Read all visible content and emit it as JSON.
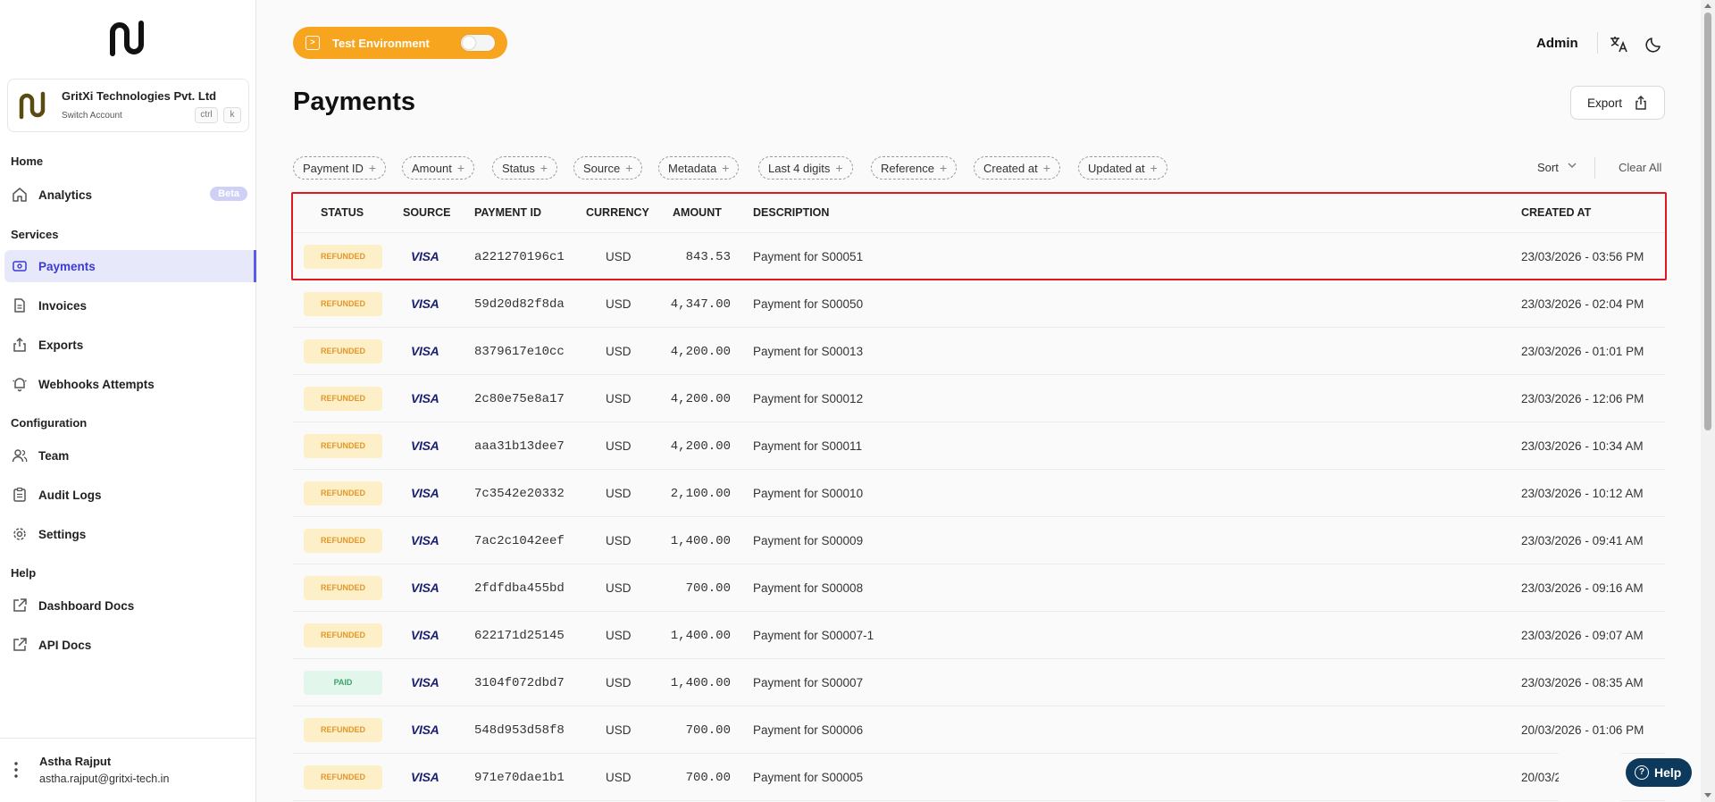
{
  "org": {
    "name": "GritXi Technologies Pvt. Ltd",
    "switch_label": "Switch Account",
    "kbd_ctrl": "ctrl",
    "kbd_k": "k"
  },
  "sidebar": {
    "sections": [
      {
        "label": "Home"
      },
      {
        "label": "Services"
      },
      {
        "label": "Configuration"
      },
      {
        "label": "Help"
      }
    ],
    "items": {
      "analytics": "Analytics",
      "analytics_badge": "Beta",
      "payments": "Payments",
      "invoices": "Invoices",
      "exports": "Exports",
      "webhooks": "Webhooks Attempts",
      "team": "Team",
      "audit_logs": "Audit Logs",
      "settings": "Settings",
      "dashboard_docs": "Dashboard Docs",
      "api_docs": "API Docs"
    }
  },
  "user": {
    "name": "Astha Rajput",
    "email": "astha.rajput@gritxi-tech.in"
  },
  "topbar": {
    "env_label": "Test Environment",
    "admin_label": "Admin"
  },
  "page": {
    "title": "Payments",
    "export_label": "Export"
  },
  "filters": [
    "Payment ID",
    "Amount",
    "Status",
    "Source",
    "Metadata",
    "Last 4 digits",
    "Reference",
    "Created at",
    "Updated at"
  ],
  "sort_label": "Sort",
  "clear_all_label": "Clear All",
  "table": {
    "headers": {
      "status": "STATUS",
      "source": "SOURCE",
      "payment_id": "PAYMENT ID",
      "currency": "CURRENCY",
      "amount": "AMOUNT",
      "description": "DESCRIPTION",
      "created_at": "CREATED AT"
    },
    "rows": [
      {
        "status": "REFUNDED",
        "source": "VISA",
        "payment_id": "a221270196c1",
        "currency": "USD",
        "amount": "843.53",
        "description": "Payment for S00051",
        "created_at": "23/03/2026 - 03:56 PM"
      },
      {
        "status": "REFUNDED",
        "source": "VISA",
        "payment_id": "59d20d82f8da",
        "currency": "USD",
        "amount": "4,347.00",
        "description": "Payment for S00050",
        "created_at": "23/03/2026 - 02:04 PM"
      },
      {
        "status": "REFUNDED",
        "source": "VISA",
        "payment_id": "8379617e10cc",
        "currency": "USD",
        "amount": "4,200.00",
        "description": "Payment for S00013",
        "created_at": "23/03/2026 - 01:01 PM"
      },
      {
        "status": "REFUNDED",
        "source": "VISA",
        "payment_id": "2c80e75e8a17",
        "currency": "USD",
        "amount": "4,200.00",
        "description": "Payment for S00012",
        "created_at": "23/03/2026 - 12:06 PM"
      },
      {
        "status": "REFUNDED",
        "source": "VISA",
        "payment_id": "aaa31b13dee7",
        "currency": "USD",
        "amount": "4,200.00",
        "description": "Payment for S00011",
        "created_at": "23/03/2026 - 10:34 AM"
      },
      {
        "status": "REFUNDED",
        "source": "VISA",
        "payment_id": "7c3542e20332",
        "currency": "USD",
        "amount": "2,100.00",
        "description": "Payment for S00010",
        "created_at": "23/03/2026 - 10:12 AM"
      },
      {
        "status": "REFUNDED",
        "source": "VISA",
        "payment_id": "7ac2c1042eef",
        "currency": "USD",
        "amount": "1,400.00",
        "description": "Payment for S00009",
        "created_at": "23/03/2026 - 09:41 AM"
      },
      {
        "status": "REFUNDED",
        "source": "VISA",
        "payment_id": "2fdfdba455bd",
        "currency": "USD",
        "amount": "700.00",
        "description": "Payment for S00008",
        "created_at": "23/03/2026 - 09:16 AM"
      },
      {
        "status": "REFUNDED",
        "source": "VISA",
        "payment_id": "622171d25145",
        "currency": "USD",
        "amount": "1,400.00",
        "description": "Payment for S00007-1",
        "created_at": "23/03/2026 - 09:07 AM"
      },
      {
        "status": "PAID",
        "source": "VISA",
        "payment_id": "3104f072dbd7",
        "currency": "USD",
        "amount": "1,400.00",
        "description": "Payment for S00007",
        "created_at": "23/03/2026 - 08:35 AM"
      },
      {
        "status": "REFUNDED",
        "source": "VISA",
        "payment_id": "548d953d58f8",
        "currency": "USD",
        "amount": "700.00",
        "description": "Payment for S00006",
        "created_at": "20/03/2026 - 01:06 PM"
      },
      {
        "status": "REFUNDED",
        "source": "VISA",
        "payment_id": "971e70dae1b1",
        "currency": "USD",
        "amount": "700.00",
        "description": "Payment for S00005",
        "created_at": "20/03/2"
      }
    ]
  },
  "help_label": "Help",
  "colors": {
    "accent": "#5b5bf0",
    "env": "#f7a51f",
    "refunded_bg": "#fdf0c8",
    "refunded_fg": "#e3962b",
    "paid_bg": "#e2f6ec",
    "paid_fg": "#3aa36b",
    "highlight": "#e0191e",
    "help_bg": "#0d3a5c"
  }
}
